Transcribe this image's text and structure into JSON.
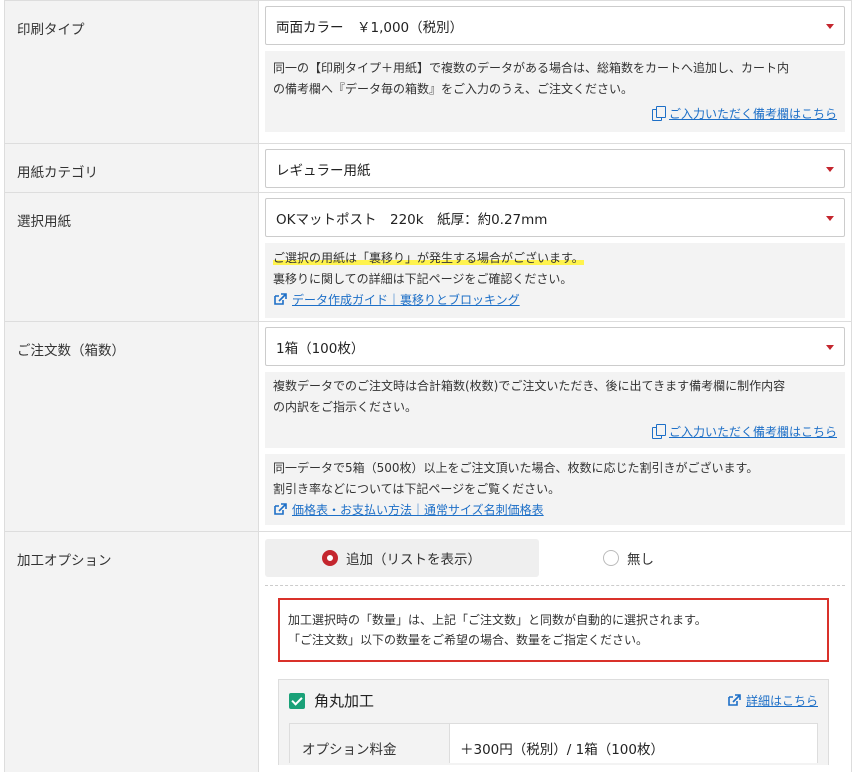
{
  "print_type": {
    "label": "印刷タイプ",
    "selected": "両面カラー　￥1,000（税別）",
    "note_line1": "同一の【印刷タイプ＋用紙】で複数のデータがある場合は、総箱数をカートへ追加し、カート内",
    "note_line2": "の備考欄へ『データ毎の箱数』をご入力のうえ、ご注文ください。",
    "note_link": "ご入力いただく備考欄はこちら"
  },
  "paper_category": {
    "label": "用紙カテゴリ",
    "selected": "レギュラー用紙"
  },
  "paper": {
    "label": "選択用紙",
    "selected": "OKマットポスト　220k　紙厚：約0.27mm",
    "note_highlight": "ご選択の用紙は「裏移り」が発生する場合がございます。",
    "note_line2": "裏移りに関しての詳細は下記ページをご確認ください。",
    "note_link": "データ作成ガイド｜裏移りとブロッキング"
  },
  "quantity": {
    "label": "ご注文数（箱数）",
    "selected": "1箱（100枚）",
    "note1_line1": "複数データでのご注文時は合計箱数(枚数)でご注文いただき、後に出てきます備考欄に制作内容",
    "note1_line2": "の内訳をご指示ください。",
    "note1_link": "ご入力いただく備考欄はこちら",
    "note2_line1": "同一データで5箱（500枚）以上をご注文頂いた場合、枚数に応じた割引きがございます。",
    "note2_line2": "割引き率などについては下記ページをご覧ください。",
    "note2_link": "価格表・お支払い方法｜通常サイズ名刺価格表"
  },
  "processing": {
    "label": "加工オプション",
    "radio_add": "追加（リストを表示）",
    "radio_none": "無し",
    "alert_line1": "加工選択時の「数量」は、上記「ご注文数」と同数が自動的に選択されます。",
    "alert_line2": "「ご注文数」以下の数量をご希望の場合、数量をご指定ください。",
    "option_title": "角丸加工",
    "option_detail_link": "詳細はこちら",
    "fee_label": "オプション料金",
    "fee_value": "＋300円（税別）/ 1箱（100枚）"
  },
  "colors": {
    "accent_red": "#c4262e",
    "link_blue": "#1d6fc7",
    "check_green": "#1aa178",
    "highlight_yellow": "#fff34d"
  }
}
